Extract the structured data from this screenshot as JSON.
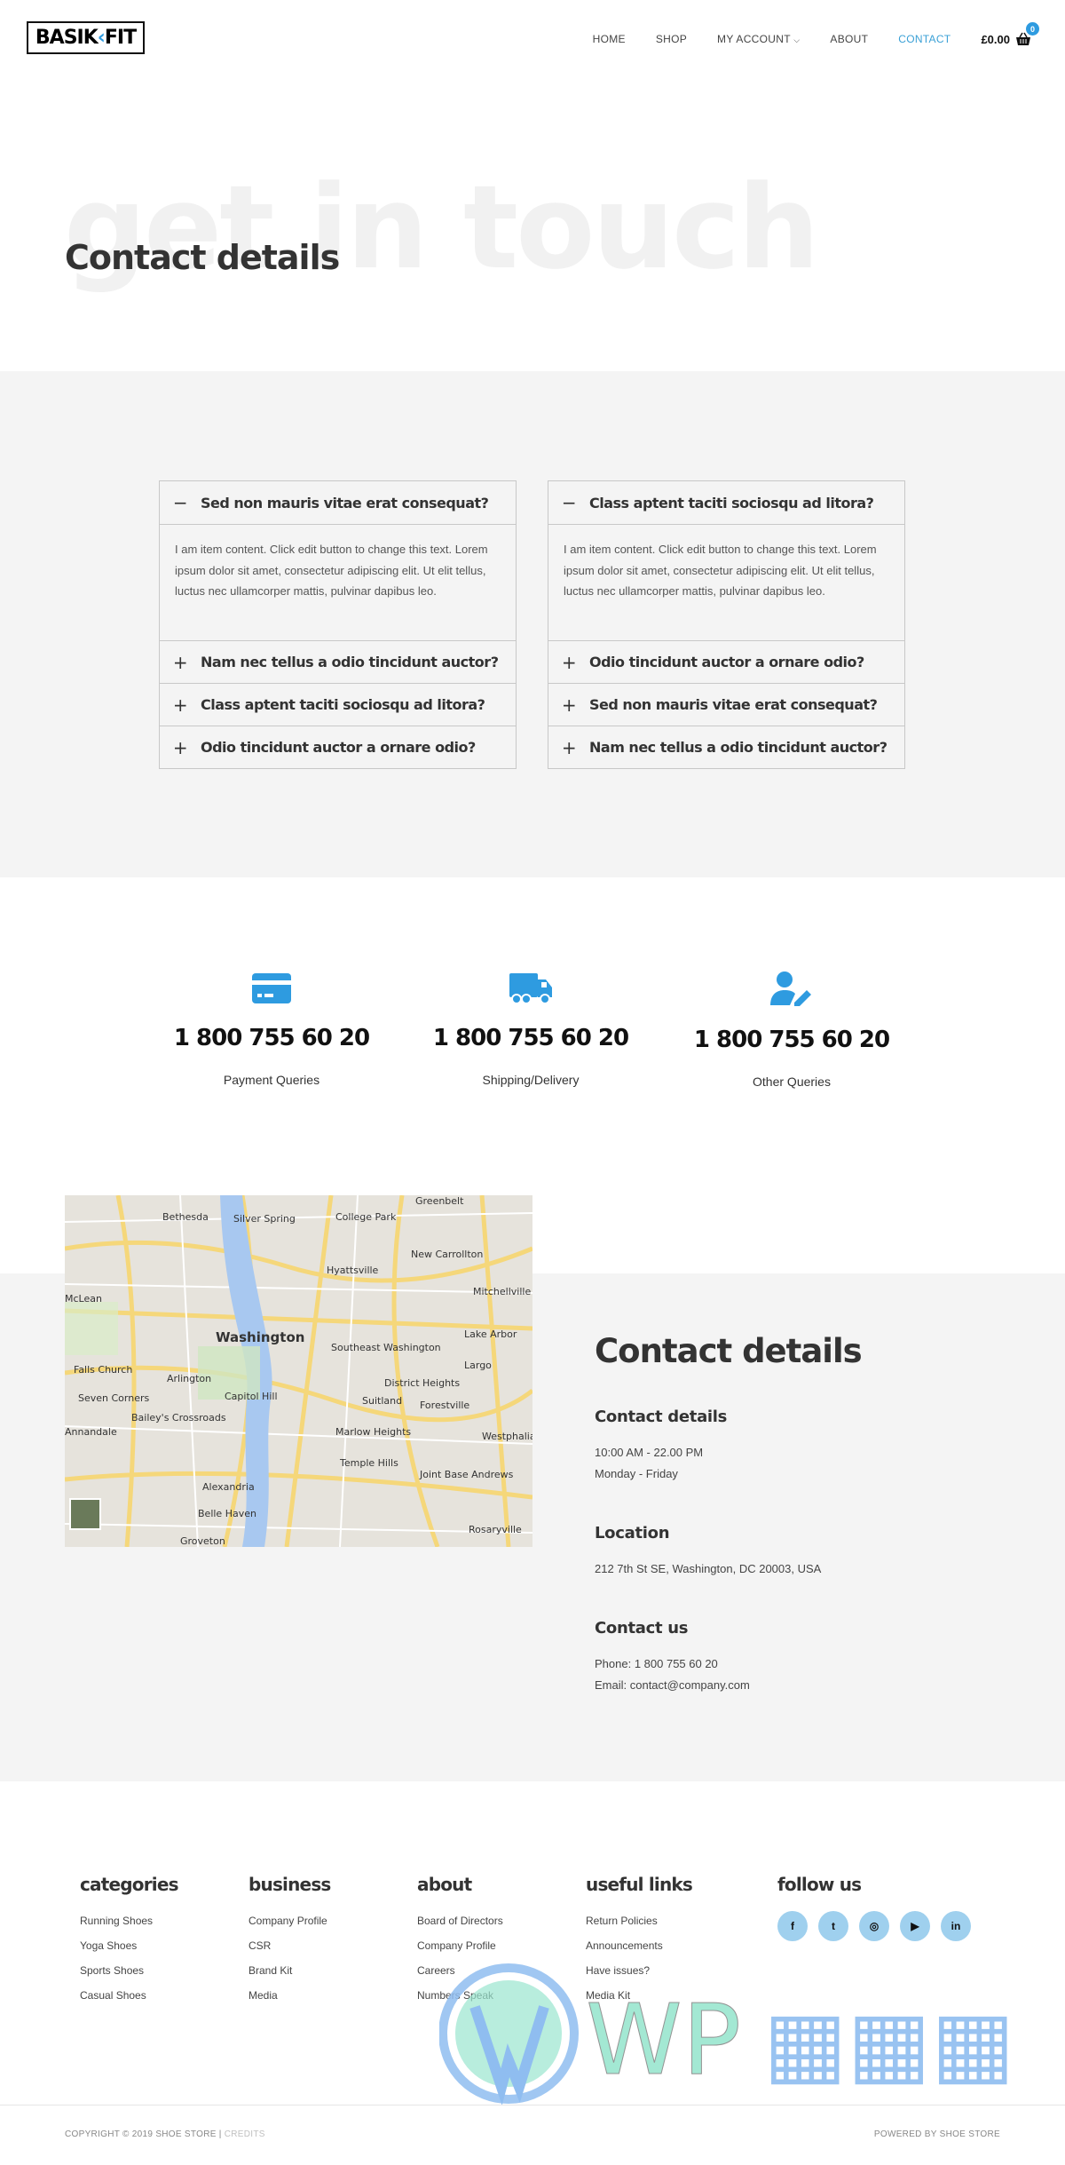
{
  "header": {
    "logo": "BASIK FIT",
    "logo_left": "BASIK",
    "logo_right": "FIT",
    "nav": [
      {
        "label": "HOME"
      },
      {
        "label": "SHOP"
      },
      {
        "label": "MY ACCOUNT"
      },
      {
        "label": "ABOUT"
      },
      {
        "label": "CONTACT",
        "active": true
      }
    ],
    "cart_total": "£0.00",
    "cart_count": "0"
  },
  "hero": {
    "background_word": "get in touch",
    "title": "Contact details"
  },
  "faq": {
    "left": {
      "open_title": "Sed non mauris vitae erat consequat?",
      "content": "I am item content. Click edit button to change this text. Lorem ipsum dolor sit amet, consectetur adipiscing elit. Ut elit tellus, luctus nec ullamcorper mattis, pulvinar dapibus leo.",
      "items": [
        "Nam nec tellus a odio tincidunt auctor?",
        "Class aptent taciti sociosqu ad litora?",
        "Odio tincidunt auctor a ornare odio?"
      ]
    },
    "right": {
      "open_title": "Class aptent taciti sociosqu ad litora?",
      "content": "I am item content. Click edit button to change this text. Lorem ipsum dolor sit amet, consectetur adipiscing elit. Ut elit tellus, luctus nec ullamcorper mattis, pulvinar dapibus leo.",
      "items": [
        "Odio tincidunt auctor a ornare odio?",
        "Sed non mauris vitae erat consequat?",
        "Nam nec tellus a odio tincidunt auctor?"
      ]
    }
  },
  "queries": [
    {
      "icon": "credit-card-icon",
      "phone": "1 800 755 60 20",
      "label": "Payment Queries"
    },
    {
      "icon": "truck-icon",
      "phone": "1 800 755 60 20",
      "label": "Shipping/Delivery"
    },
    {
      "icon": "user-edit-icon",
      "phone": "1 800 755 60 20",
      "label": "Other Queries"
    }
  ],
  "map": {
    "places": [
      "Washington",
      "Arlington",
      "Alexandria",
      "Silver Spring",
      "Bethesda",
      "College Park",
      "Greenbelt",
      "Hyattsville",
      "New Carrollton",
      "McLean",
      "Falls Church",
      "Seven Corners",
      "Bailey's Crossroads",
      "Suitland",
      "Temple Hills",
      "Marlow Heights",
      "District Heights",
      "Forestville",
      "Largo",
      "Lake Arbor",
      "Mitchellville",
      "Westphalia",
      "Joint Base Andrews",
      "Belle Haven",
      "Rosaryville",
      "Annandale",
      "Groveton",
      "Capitol Hill",
      "Southeast Washington"
    ]
  },
  "contact": {
    "title": "Contact details",
    "hours_heading": "Contact details",
    "hours": "10:00 AM - 22.00 PM",
    "days": "Monday - Friday",
    "location_heading": "Location",
    "address": "212 7th St SE, Washington, DC 20003, USA",
    "contact_heading": "Contact us",
    "phone": "Phone: 1 800 755 60 20",
    "email": "Email: contact@company.com"
  },
  "footer": {
    "columns": [
      {
        "heading": "categories",
        "links": [
          "Running Shoes",
          "Yoga Shoes",
          "Sports Shoes",
          "Casual Shoes"
        ]
      },
      {
        "heading": "business",
        "links": [
          "Company Profile",
          "CSR",
          "Brand Kit",
          "Media"
        ]
      },
      {
        "heading": "about",
        "links": [
          "Board of Directors",
          "Company Profile",
          "Careers",
          "Numbers Speak"
        ]
      },
      {
        "heading": "useful links",
        "links": [
          "Return Policies",
          "Announcements",
          "Have issues?",
          "Media Kit"
        ]
      }
    ],
    "follow_heading": "follow us",
    "social": [
      {
        "icon": "facebook-icon",
        "glyph": "f"
      },
      {
        "icon": "twitter-icon",
        "glyph": "t"
      },
      {
        "icon": "instagram-icon",
        "glyph": "◎"
      },
      {
        "icon": "youtube-icon",
        "glyph": "▶"
      },
      {
        "icon": "linkedin-icon",
        "glyph": "in"
      }
    ],
    "copyright": "COPYRIGHT © 2019 SHOE STORE | ",
    "credits": "CREDITS",
    "powered": "POWERED BY SHOE STORE"
  },
  "watermark": "WP资源海",
  "colors": {
    "accent": "#2e9be0",
    "section_gray": "#f4f4f4",
    "social_bg": "#9fd0ee"
  }
}
